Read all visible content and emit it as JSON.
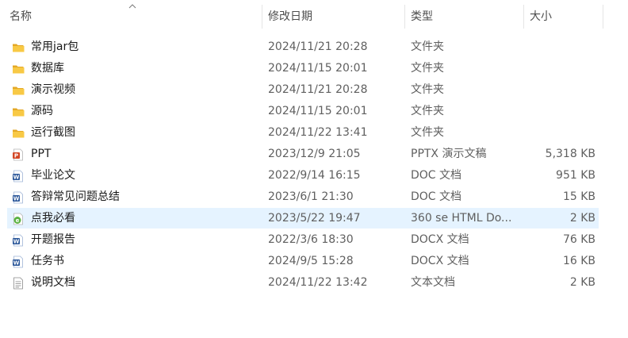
{
  "columns": {
    "name": "名称",
    "date": "修改日期",
    "type": "类型",
    "size": "大小"
  },
  "sort": {
    "column": "name",
    "direction": "ascending",
    "icon": "chevron-up-icon"
  },
  "colors": {
    "folder": "#f8c945",
    "folder_dark": "#e4a826",
    "ppt": "#d24726",
    "doc": "#2b579a",
    "html": "#5bb342",
    "selected_row": "#e5f3ff"
  },
  "files": [
    {
      "name": "常用jar包",
      "date": "2024/11/21 20:28",
      "type": "文件夹",
      "size": "",
      "icon": "folder-icon"
    },
    {
      "name": "数据库",
      "date": "2024/11/15 20:01",
      "type": "文件夹",
      "size": "",
      "icon": "folder-icon"
    },
    {
      "name": "演示视频",
      "date": "2024/11/21 20:28",
      "type": "文件夹",
      "size": "",
      "icon": "folder-icon"
    },
    {
      "name": "源码",
      "date": "2024/11/15 20:01",
      "type": "文件夹",
      "size": "",
      "icon": "folder-icon"
    },
    {
      "name": "运行截图",
      "date": "2024/11/22 13:41",
      "type": "文件夹",
      "size": "",
      "icon": "folder-icon"
    },
    {
      "name": "PPT",
      "date": "2023/12/9 21:05",
      "type": "PPTX 演示文稿",
      "size": "5,318 KB",
      "icon": "pptx-file-icon"
    },
    {
      "name": "毕业论文",
      "date": "2022/9/14 16:15",
      "type": "DOC 文档",
      "size": "951 KB",
      "icon": "doc-file-icon"
    },
    {
      "name": "答辩常见问题总结",
      "date": "2023/6/1 21:30",
      "type": "DOC 文档",
      "size": "15 KB",
      "icon": "doc-file-icon"
    },
    {
      "name": "点我必看",
      "date": "2023/5/22 19:47",
      "type": "360 se HTML Do...",
      "size": "2 KB",
      "icon": "html-file-icon",
      "selected": true
    },
    {
      "name": "开题报告",
      "date": "2022/3/6 18:30",
      "type": "DOCX 文档",
      "size": "76 KB",
      "icon": "doc-file-icon"
    },
    {
      "name": "任务书",
      "date": "2024/9/5 15:28",
      "type": "DOCX 文档",
      "size": "16 KB",
      "icon": "doc-file-icon"
    },
    {
      "name": "说明文档",
      "date": "2024/11/22 13:42",
      "type": "文本文档",
      "size": "2 KB",
      "icon": "text-file-icon"
    }
  ]
}
